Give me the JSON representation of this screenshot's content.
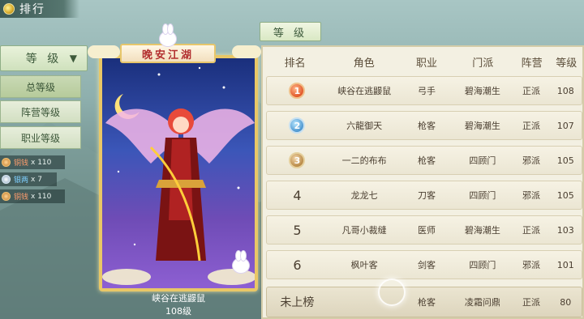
{
  "header": {
    "title": "排行"
  },
  "left_menu": {
    "dropdown_label": "等 级",
    "items": [
      {
        "label": "总等级",
        "active": true
      },
      {
        "label": "阵营等级",
        "active": false
      },
      {
        "label": "职业等级",
        "active": false
      }
    ]
  },
  "drops": [
    {
      "name": "铜钱",
      "count": "x 110",
      "type": "copper"
    },
    {
      "name": "银两",
      "count": "x 7",
      "type": "silver"
    },
    {
      "name": "铜钱",
      "count": "x 110",
      "type": "copper"
    }
  ],
  "card": {
    "banner": "晚安江湖",
    "name": "峡谷在逃鼹鼠",
    "level": "108级"
  },
  "tab": {
    "label": "等 级"
  },
  "table": {
    "headers": [
      "排名",
      "角色",
      "职业",
      "门派",
      "阵营",
      "等级"
    ],
    "rows": [
      {
        "rank": "1",
        "medal": "gold",
        "name": "峡谷在逃鼹鼠",
        "job": "弓手",
        "sect": "碧海潮生",
        "camp": "正派",
        "level": "108"
      },
      {
        "rank": "2",
        "medal": "silver",
        "name": "六龍御天",
        "job": "枪客",
        "sect": "碧海潮生",
        "camp": "正派",
        "level": "107"
      },
      {
        "rank": "3",
        "medal": "bronze",
        "name": "一二的布布",
        "job": "枪客",
        "sect": "四顾门",
        "camp": "邪派",
        "level": "105"
      },
      {
        "rank": "4",
        "medal": "",
        "name": "龙龙七",
        "job": "刀客",
        "sect": "四顾门",
        "camp": "邪派",
        "level": "105"
      },
      {
        "rank": "5",
        "medal": "",
        "name": "凡哥小裁缝",
        "job": "医师",
        "sect": "碧海潮生",
        "camp": "正派",
        "level": "103"
      },
      {
        "rank": "6",
        "medal": "",
        "name": "枫叶客",
        "job": "剑客",
        "sect": "四顾门",
        "camp": "邪派",
        "level": "101"
      }
    ],
    "own_row": {
      "rank": "未上榜",
      "name": "",
      "job": "枪客",
      "sect": "凌霜问鼎",
      "camp": "正派",
      "level": "80"
    }
  }
}
